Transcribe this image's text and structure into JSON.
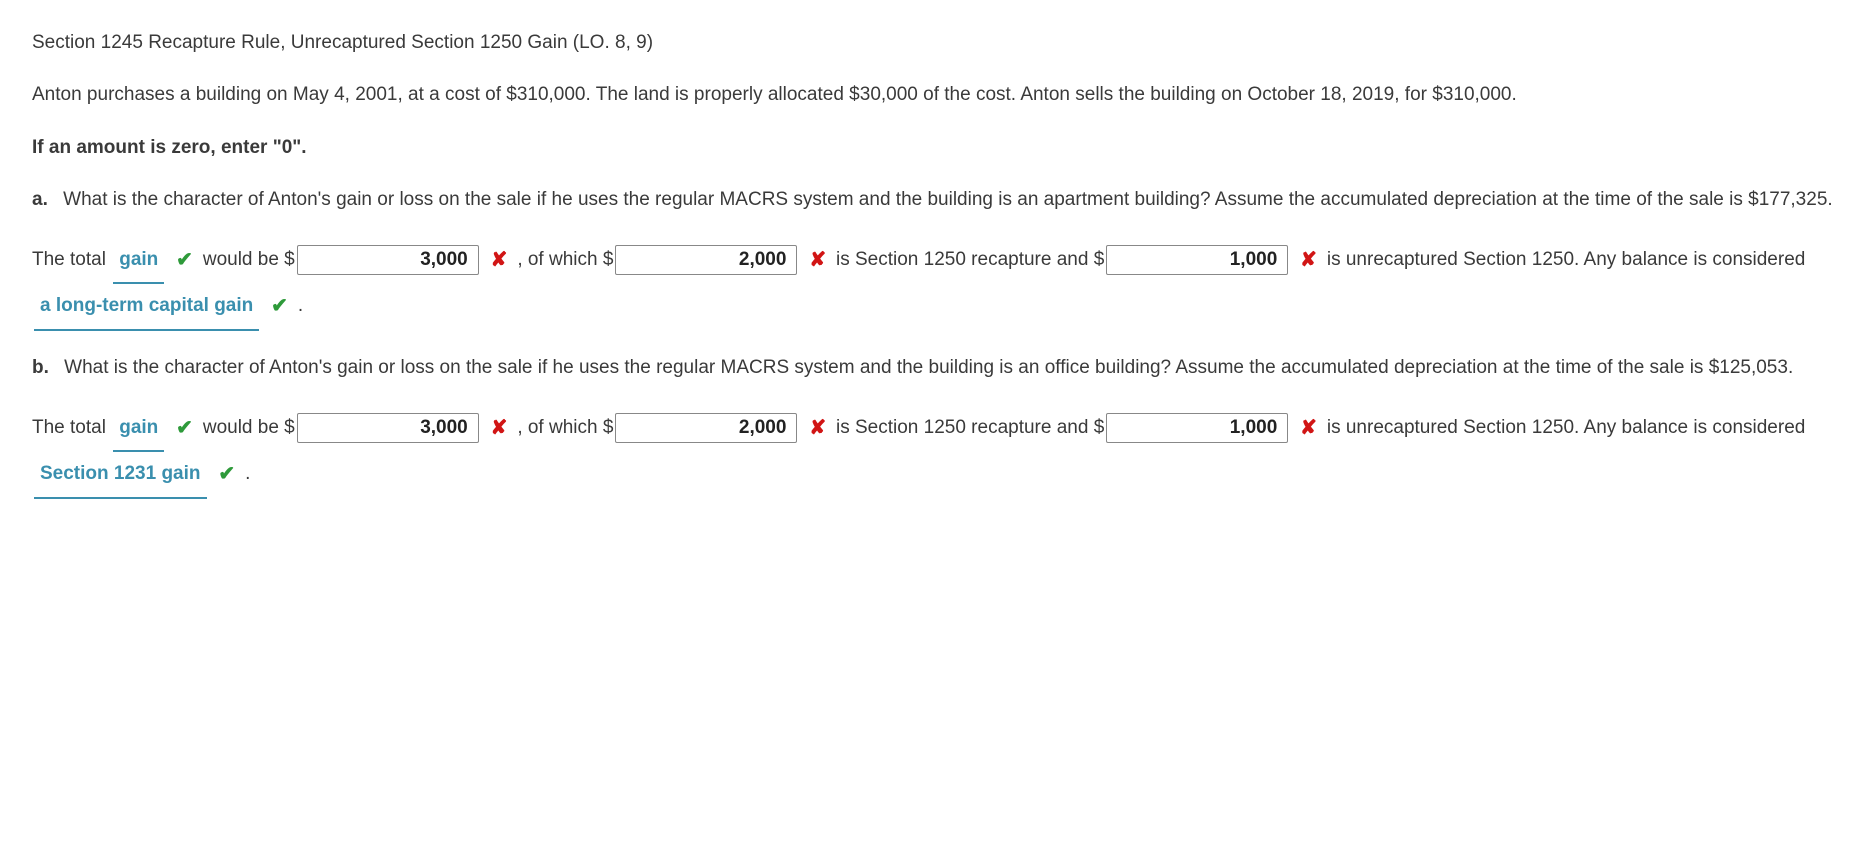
{
  "title": "Section 1245 Recapture Rule, Unrecaptured Section 1250 Gain (LO. 8, 9)",
  "scenario": "Anton purchases a building on May 4, 2001, at a cost of $310,000. The land is properly allocated $30,000 of the cost. Anton sells the building on October 18, 2019, for $310,000.",
  "instruction": "If an amount is zero, enter \"0\".",
  "marks": {
    "check": "✔",
    "cross": "✘"
  },
  "a": {
    "label": "a.",
    "question": "What is the character of Anton's gain or loss on the sale if he uses the regular MACRS system and the building is an apartment building? Assume the accumulated depreciation at the time of the sale is $177,325.",
    "t1": "The total",
    "drop1": "gain",
    "drop1_correct": true,
    "t2": "would be $",
    "val1": "3,000",
    "val1_correct": false,
    "t3": ", of which $",
    "val2": "2,000",
    "val2_correct": false,
    "t4": "is Section 1250 recapture and $",
    "val3": "1,000",
    "val3_correct": false,
    "t5": "is",
    "t6": "unrecaptured Section 1250. Any balance is considered",
    "drop2": "a long-term capital gain",
    "drop2_correct": true,
    "t7": "."
  },
  "b": {
    "label": "b.",
    "question": "What is the character of Anton's gain or loss on the sale if he uses the regular MACRS system and the building is an office building? Assume the accumulated depreciation at the time of the sale is $125,053.",
    "t1": "The total",
    "drop1": "gain",
    "drop1_correct": true,
    "t2": "would be $",
    "val1": "3,000",
    "val1_correct": false,
    "t3": ", of which $",
    "val2": "2,000",
    "val2_correct": false,
    "t4": "is Section 1250 recapture and $",
    "val3": "1,000",
    "val3_correct": false,
    "t5": "is",
    "t6": "unrecaptured Section 1250. Any balance is considered",
    "drop2": "Section 1231 gain",
    "drop2_correct": true,
    "t7": "."
  }
}
